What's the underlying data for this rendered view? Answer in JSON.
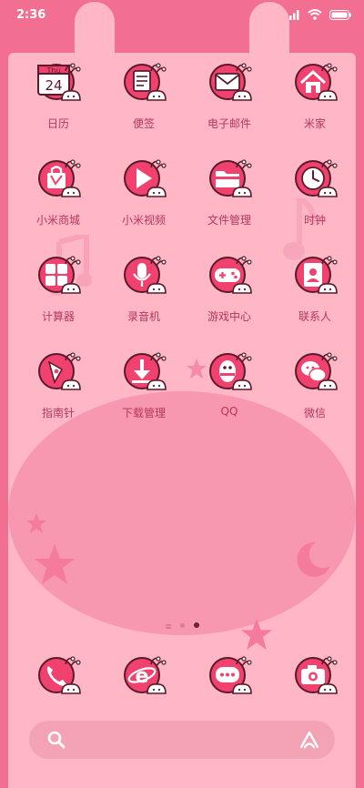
{
  "status_bar": {
    "time": "2:36",
    "icons": [
      "signal-icon",
      "wifi-icon",
      "battery-icon"
    ]
  },
  "theme": {
    "accent": "#f0416f",
    "icon_bg": "#f0416f",
    "label_color": "#b4385b",
    "panel": "#ffb7c6",
    "blob": "#f797b0",
    "frame": "#f36f92"
  },
  "apps": [
    {
      "label": "日历",
      "icon": "calendar-icon",
      "month": "Thu",
      "day": "24"
    },
    {
      "label": "便签",
      "icon": "notes-icon"
    },
    {
      "label": "电子邮件",
      "icon": "mail-icon"
    },
    {
      "label": "米家",
      "icon": "home-icon"
    },
    {
      "label": "小米商城",
      "icon": "shopping-bag-icon"
    },
    {
      "label": "小米视频",
      "icon": "play-icon"
    },
    {
      "label": "文件管理",
      "icon": "folder-icon"
    },
    {
      "label": "时钟",
      "icon": "clock-icon"
    },
    {
      "label": "计算器",
      "icon": "calculator-icon"
    },
    {
      "label": "录音机",
      "icon": "microphone-icon"
    },
    {
      "label": "游戏中心",
      "icon": "gamepad-icon"
    },
    {
      "label": "联系人",
      "icon": "contacts-icon"
    },
    {
      "label": "指南针",
      "icon": "compass-icon"
    },
    {
      "label": "下载管理",
      "icon": "download-icon"
    },
    {
      "label": "QQ",
      "icon": "qq-icon"
    },
    {
      "label": "微信",
      "icon": "wechat-icon"
    }
  ],
  "dock": [
    {
      "icon": "phone-icon"
    },
    {
      "icon": "browser-icon"
    },
    {
      "icon": "messages-icon"
    },
    {
      "icon": "camera-icon"
    }
  ],
  "page_indicator": {
    "pages": 3,
    "current": 2
  },
  "search_bar": {
    "left_icon": "search-icon",
    "right_icon": "assistant-icon"
  }
}
